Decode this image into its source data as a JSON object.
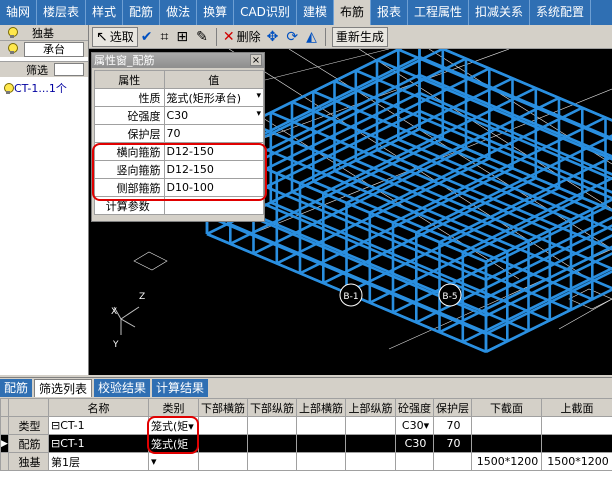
{
  "menu": {
    "tabs": [
      "轴网",
      "楼层表",
      "样式",
      "配筋",
      "做法",
      "换算",
      "CAD识别",
      "建模",
      "布筋",
      "报表",
      "工程属性",
      "扣减关系",
      "系统配置"
    ],
    "active_index": 8
  },
  "left_panel": {
    "category": "独基",
    "sub_category": "承台",
    "filter_label": "筛选",
    "items": [
      "CT-1...1个"
    ]
  },
  "toolbar": {
    "select_label": "选取",
    "delete_label": "删除",
    "regenerate_label": "重新生成"
  },
  "property_window": {
    "title": "属性窗_配筋",
    "header_key": "属性",
    "header_value": "值",
    "rows": [
      {
        "key": "性质",
        "value": "笼式(矩形承台)"
      },
      {
        "key": "砼强度",
        "value": "C30"
      },
      {
        "key": "保护层",
        "value": "70"
      },
      {
        "key": "横向箍筋",
        "value": "D12-150"
      },
      {
        "key": "竖向箍筋",
        "value": "D12-150"
      },
      {
        "key": "侧部箍筋",
        "value": "D10-100"
      },
      {
        "key": "计算参数",
        "value": ""
      }
    ]
  },
  "viewport": {
    "labels": [
      "B-1",
      "B-5"
    ],
    "axes": {
      "z": "Z",
      "y": "Y",
      "x": "X"
    },
    "rebar_color": "#2a8fe0"
  },
  "bottom_tabs": [
    "配筋",
    "筛选列表",
    "校验结果",
    "计算结果"
  ],
  "bottom_active_index": 1,
  "grid": {
    "columns": [
      "",
      "名称",
      "类别",
      "下部横筋",
      "下部纵筋",
      "上部横筋",
      "上部纵筋",
      "砼强度",
      "保护层",
      "下截面",
      "上截面"
    ],
    "rows": [
      {
        "head": "类型",
        "cells": [
          "⊟CT-1",
          "笼式(矩▾",
          "",
          "",
          "",
          "",
          "C30▾",
          "70",
          "",
          ""
        ]
      },
      {
        "head": "配筋",
        "cells": [
          "   ⊟CT-1",
          "笼式(矩",
          "",
          "",
          "",
          "",
          "C30",
          "70",
          "",
          ""
        ]
      },
      {
        "head": "独基",
        "cells": [
          "第1层",
          "▾",
          "",
          "",
          "",
          "",
          "",
          "",
          "1500*1200",
          "1500*1200"
        ]
      }
    ]
  }
}
